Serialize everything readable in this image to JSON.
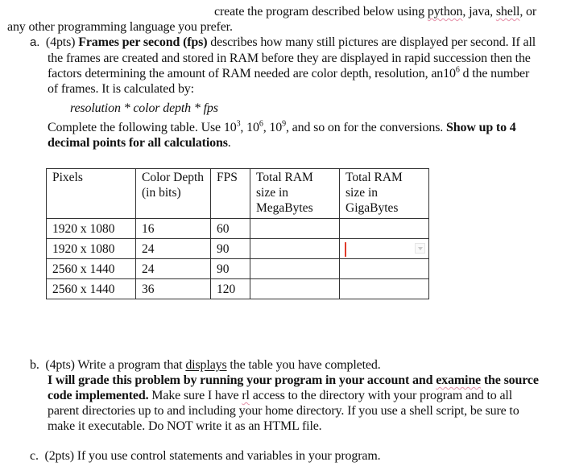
{
  "intro": {
    "line1_pre": "create the program described below using ",
    "lang1": "python",
    "sep1": ", java, ",
    "lang2": "shell",
    "line1_post": ", or",
    "line2": "any other programming language you prefer."
  },
  "part_a": {
    "marker": "a.",
    "points": "(4pts) ",
    "bold_term": "Frames per second (fps)",
    "line1_rest": " describes how many still pictures are displayed per second. If all",
    "line2": "the frames are created and stored in RAM before they are displayed in rapid succession then the",
    "line3_pre": "factors determining the amount of RAM needed are color depth, resolution, an10",
    "line3_sup": "6",
    "line3_post": " d the number",
    "line4": "of frames. It is calculated by:",
    "formula": "resolution * color depth * fps",
    "instr_pre": "Complete the following table. Use 10",
    "sup3": "3",
    "comma1": ", 10",
    "sup6": "6",
    "comma2": ", 10",
    "sup9": "9",
    "instr_mid": ", and so on for the conversions. ",
    "instr_bold1": "Show up to 4",
    "instr_bold2": "decimal points for all calculations",
    "instr_end": "."
  },
  "table": {
    "headers": [
      "Pixels",
      "Color Depth (in bits)",
      "FPS",
      "Total RAM size in MegaBytes",
      "Total RAM size in GigaBytes"
    ],
    "rows": [
      {
        "pixels": "1920 x 1080",
        "depth": "16",
        "fps": "60",
        "mb": "",
        "gb": ""
      },
      {
        "pixels": "1920 x 1080",
        "depth": "24",
        "fps": "90",
        "mb": "",
        "gb": ""
      },
      {
        "pixels": "2560 x 1440",
        "depth": "24",
        "fps": "90",
        "mb": "",
        "gb": ""
      },
      {
        "pixels": "2560 x 1440",
        "depth": "36",
        "fps": "120",
        "mb": "",
        "gb": ""
      }
    ]
  },
  "part_b": {
    "marker": "b.",
    "l1_pre": "(4pts) Write a program that ",
    "l1_link": "displays",
    "l1_post": " the table you have completed.",
    "l2_bold_pre": "I will grade this problem by running your program in your account and ",
    "l2_bold_spell": "examine",
    "l2_bold_post": " the source",
    "l3_bold": "code implemented.",
    "l3_pre": " Make sure I have ",
    "l3_spell": "rl",
    "l3_post": " access to the directory with your program and to all",
    "l4": "parent directories up to and including your home directory. If you use a shell script, be sure to",
    "l5": "make it executable. Do NOT write it as an HTML file."
  },
  "part_c": {
    "marker": "c.",
    "text": "(2pts) If you use control statements and variables in your program."
  },
  "colors": {
    "spellcheck_underline": "#e58fa8",
    "cursor": "#e03a2a"
  }
}
